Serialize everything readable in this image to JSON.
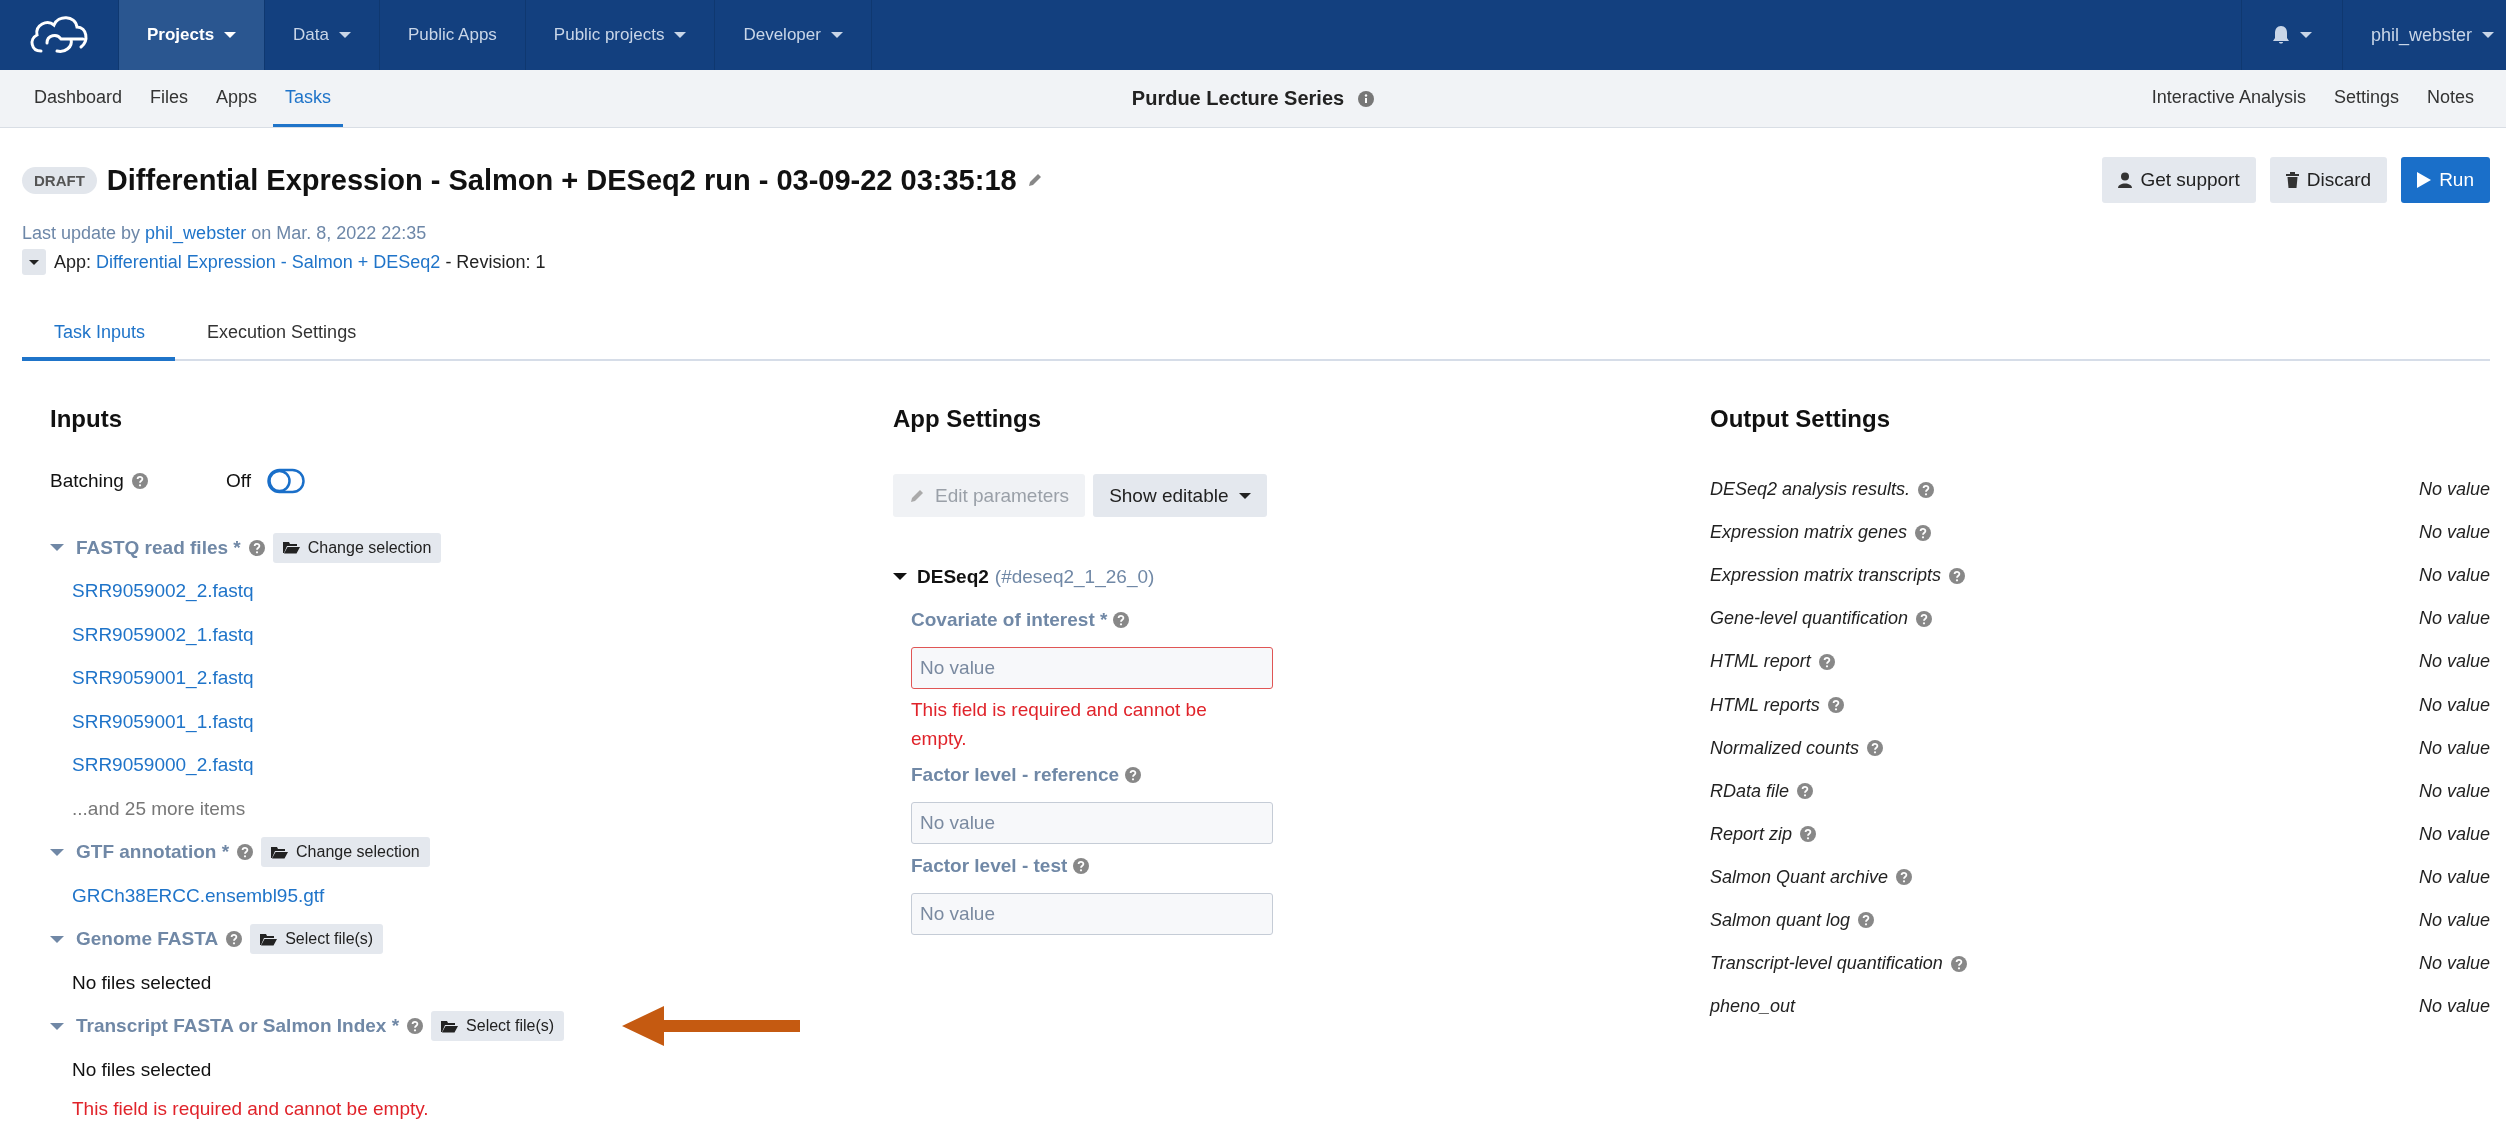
{
  "nav": {
    "items": [
      {
        "label": "Projects",
        "caret": true,
        "selected": true
      },
      {
        "label": "Data",
        "caret": true,
        "selected": false
      },
      {
        "label": "Public Apps",
        "caret": false,
        "selected": false
      },
      {
        "label": "Public projects",
        "caret": true,
        "selected": false
      },
      {
        "label": "Developer",
        "caret": true,
        "selected": false
      }
    ],
    "user": "phil_webster"
  },
  "subnav": {
    "items": [
      {
        "label": "Dashboard",
        "selected": false
      },
      {
        "label": "Files",
        "selected": false
      },
      {
        "label": "Apps",
        "selected": false
      },
      {
        "label": "Tasks",
        "selected": true
      }
    ],
    "project": "Purdue Lecture Series",
    "right_links": [
      "Interactive Analysis",
      "Settings",
      "Notes"
    ]
  },
  "task": {
    "status": "DRAFT",
    "title": "Differential Expression - Salmon + DESeq2 run - 03-09-22 03:35:18",
    "update_prefix": "Last update by",
    "update_user": "phil_webster",
    "update_suffix": "on Mar. 8, 2022 22:35",
    "app_prefix": "App:",
    "app_link": "Differential Expression - Salmon + DESeq2",
    "app_suffix": "- Revision: 1"
  },
  "actions": [
    {
      "label": "Get support",
      "kind": "support"
    },
    {
      "label": "Discard",
      "kind": "discard"
    },
    {
      "label": "Run",
      "kind": "run"
    }
  ],
  "tabs": [
    {
      "label": "Task Inputs",
      "selected": true
    },
    {
      "label": "Execution Settings",
      "selected": false
    }
  ],
  "inputs": {
    "title": "Inputs",
    "batching": {
      "label": "Batching",
      "state_text": "Off",
      "on": false
    },
    "groups": [
      {
        "label": "FASTQ read files *",
        "button": "Change selection",
        "expanded": true,
        "annotated": false,
        "files": [
          "SRR9059002_2.fastq",
          "SRR9059002_1.fastq",
          "SRR9059001_2.fastq",
          "SRR9059001_1.fastq",
          "SRR9059000_2.fastq"
        ],
        "more": "...and 25 more items"
      },
      {
        "label": "GTF annotation *",
        "button": "Change selection",
        "expanded": true,
        "annotated": false,
        "files": [
          "GRCh38ERCC.ensembl95.gtf"
        ]
      },
      {
        "label": "Genome FASTA",
        "button": "Select file(s)",
        "expanded": true,
        "annotated": false,
        "empty_text": "No files selected"
      },
      {
        "label": "Transcript FASTA or Salmon Index *",
        "button": "Select file(s)",
        "expanded": true,
        "annotated": true,
        "empty_text": "No files selected",
        "error": "This field is required and cannot be empty."
      }
    ]
  },
  "app_settings": {
    "title": "App Settings",
    "edit_button": {
      "label": "Edit parameters",
      "disabled": true
    },
    "show_button": "Show editable",
    "node": {
      "name": "DESeq2",
      "id": "(#deseq2_1_26_0)",
      "expanded": true
    },
    "fields": [
      {
        "label": "Covariate of interest *",
        "placeholder": "No value",
        "error": "This field is required and cannot be empty."
      },
      {
        "label": "Factor level - reference",
        "placeholder": "No value"
      },
      {
        "label": "Factor level - test",
        "placeholder": "No value"
      }
    ]
  },
  "output_settings": {
    "title": "Output Settings",
    "rows": [
      {
        "label": "DESeq2 analysis results.",
        "help": true,
        "value": "No value"
      },
      {
        "label": "Expression matrix genes",
        "help": true,
        "value": "No value"
      },
      {
        "label": "Expression matrix transcripts",
        "help": true,
        "value": "No value"
      },
      {
        "label": "Gene-level quantification",
        "help": true,
        "value": "No value"
      },
      {
        "label": "HTML report",
        "help": true,
        "value": "No value"
      },
      {
        "label": "HTML reports",
        "help": true,
        "value": "No value"
      },
      {
        "label": "Normalized counts",
        "help": true,
        "value": "No value"
      },
      {
        "label": "RData file",
        "help": true,
        "value": "No value"
      },
      {
        "label": "Report zip",
        "help": true,
        "value": "No value"
      },
      {
        "label": "Salmon Quant archive",
        "help": true,
        "value": "No value"
      },
      {
        "label": "Salmon quant log",
        "help": true,
        "value": "No value"
      },
      {
        "label": "Transcript-level quantification",
        "help": true,
        "value": "No value"
      },
      {
        "label": "pheno_out",
        "help": false,
        "value": "No value"
      }
    ]
  }
}
